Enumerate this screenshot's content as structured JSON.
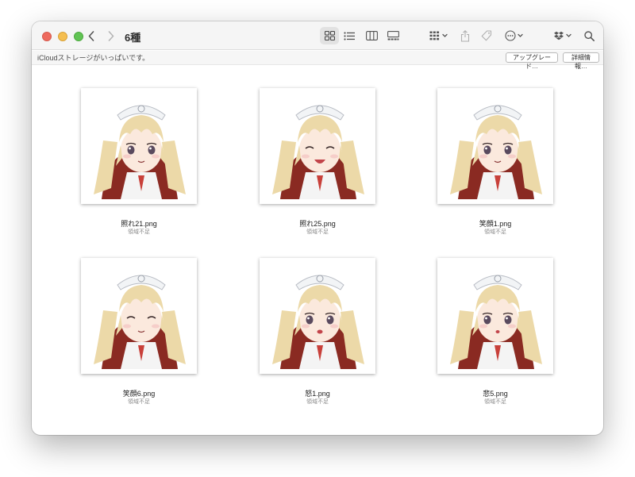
{
  "window": {
    "title": "6種"
  },
  "toolbar": {
    "icons": [
      "back-chevron-icon",
      "forward-chevron-icon",
      "icon-view-icon",
      "list-view-icon",
      "column-view-icon",
      "gallery-view-icon",
      "group-icon",
      "share-icon",
      "tag-icon",
      "action-icon",
      "dropbox-icon",
      "search-icon"
    ]
  },
  "banner": {
    "message": "iCloudストレージがいっぱいです。",
    "upgrade_label": "アップグレード…",
    "details_label": "詳細情報…"
  },
  "files": [
    {
      "name": "照れ21.png",
      "status": "領域不足",
      "expression": "smile"
    },
    {
      "name": "照れ25.png",
      "status": "領域不足",
      "expression": "laugh"
    },
    {
      "name": "笑顔1.png",
      "status": "領域不足",
      "expression": "smile"
    },
    {
      "name": "笑顔6.png",
      "status": "領域不足",
      "expression": "closed"
    },
    {
      "name": "怒1.png",
      "status": "領域不足",
      "expression": "open"
    },
    {
      "name": "悲5.png",
      "status": "領域不足",
      "expression": "worried"
    }
  ],
  "colors": {
    "close": "#ee6a5e",
    "minimize": "#f5be4f",
    "maximize": "#61c454",
    "hair": "#ecd9a8",
    "cape": "#8a2a22"
  }
}
